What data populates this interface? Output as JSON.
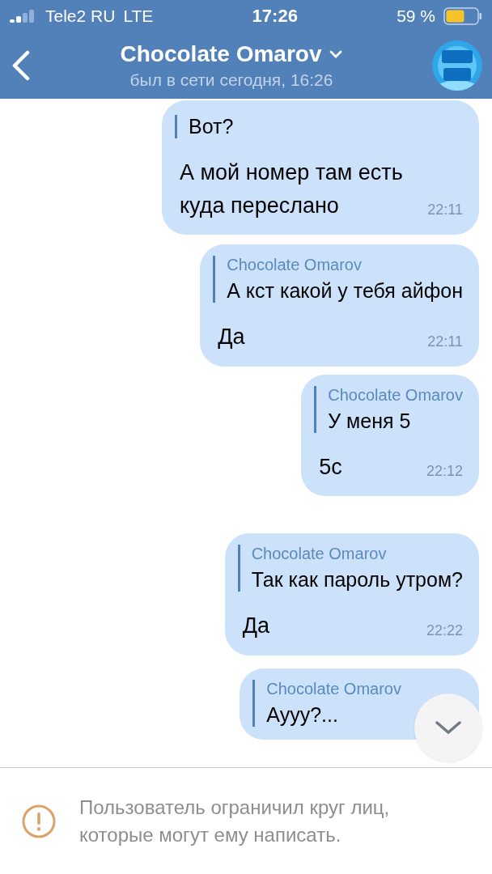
{
  "status_bar": {
    "carrier": "Tele2 RU",
    "network": "LTE",
    "time": "17:26",
    "battery_percent": "59 %"
  },
  "header": {
    "title": "Chocolate Omarov",
    "subtitle": "был в сети сегодня, 16:26"
  },
  "messages": [
    {
      "reply": {
        "text": "Вот?"
      },
      "text": "А мой номер там есть куда переслано",
      "time": "22:11"
    },
    {
      "reply": {
        "name": "Chocolate Omarov",
        "text": "А кст какой у тебя айфон"
      },
      "text": "Да",
      "time": "22:11"
    },
    {
      "reply": {
        "name": "Chocolate Omarov",
        "text": "У меня 5"
      },
      "text": "5с",
      "time": "22:12"
    },
    {
      "reply": {
        "name": "Chocolate Omarov",
        "text": "Так как пароль утром?"
      },
      "text": "Да",
      "time": "22:22"
    },
    {
      "reply": {
        "name": "Chocolate Omarov",
        "text": "Аууу?..."
      }
    }
  ],
  "notice": {
    "text": "Пользователь ограничил круг лиц, которые могут ему написать."
  }
}
